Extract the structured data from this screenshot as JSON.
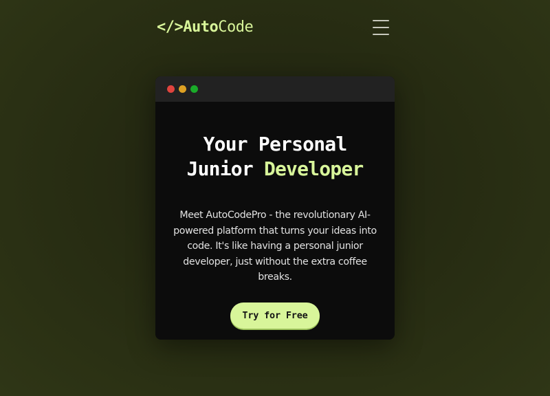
{
  "header": {
    "logo": {
      "symbol": "</>",
      "bold": "Auto",
      "light": "Code"
    },
    "menu_icon": "hamburger-menu-icon"
  },
  "window": {
    "dots": [
      {
        "name": "close",
        "color": "#e0443e"
      },
      {
        "name": "minimize",
        "color": "#dea123"
      },
      {
        "name": "maximize",
        "color": "#1aab29"
      }
    ]
  },
  "hero": {
    "headline_line1": "Your Personal",
    "headline_line2_plain": "Junior ",
    "headline_line2_accent": "Developer",
    "description": "Meet AutoCodePro - the revolutionary AI-powered platform that turns your ideas into code. It's like having a personal junior developer, just without the extra coffee breaks.",
    "cta_label": "Try for Free"
  },
  "colors": {
    "accent": "#d8f59a",
    "background": "#262b12",
    "card": "#0c0c0c",
    "titlebar": "#222222"
  }
}
